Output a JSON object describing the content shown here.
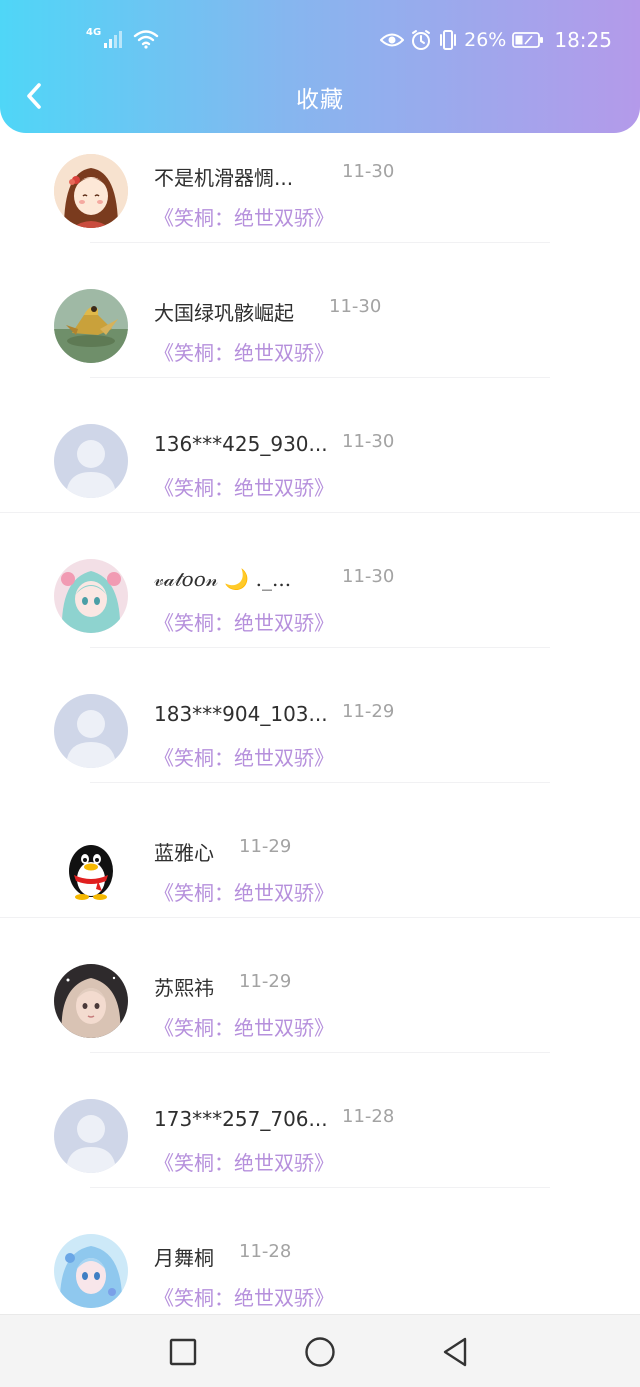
{
  "status_bar": {
    "network": "4G",
    "battery": "26%",
    "time": "18:25"
  },
  "header": {
    "title": "收藏"
  },
  "items": [
    {
      "name": "不是机滑器惆...",
      "date": "11-30",
      "book": "《笑桐：绝世双骄》",
      "avatar": "girl-cartoon"
    },
    {
      "name": "大国绿巩骸崛起",
      "date": "11-30",
      "book": "《笑桐：绝世双骄》",
      "avatar": "bird"
    },
    {
      "name": "136***425_930...",
      "date": "11-30",
      "book": "《笑桐：绝世双骄》",
      "avatar": "default"
    },
    {
      "name": "𝓋𝒶𝓉𝑜𝑜𝓃 🌙 ._...",
      "date": "11-30",
      "book": "《笑桐：绝世双骄》",
      "avatar": "anime"
    },
    {
      "name": "183***904_103...",
      "date": "11-29",
      "book": "《笑桐：绝世双骄》",
      "avatar": "default"
    },
    {
      "name": "蓝雅心",
      "date": "11-29",
      "book": "《笑桐：绝世双骄》",
      "avatar": "penguin"
    },
    {
      "name": "苏熙祎",
      "date": "11-29",
      "book": "《笑桐：绝世双骄》",
      "avatar": "photo"
    },
    {
      "name": "173***257_706...",
      "date": "11-28",
      "book": "《笑桐：绝世双骄》",
      "avatar": "default"
    },
    {
      "name": "月舞桐",
      "date": "11-28",
      "book": "《笑桐：绝世双骄》",
      "avatar": "anime-blue"
    }
  ]
}
